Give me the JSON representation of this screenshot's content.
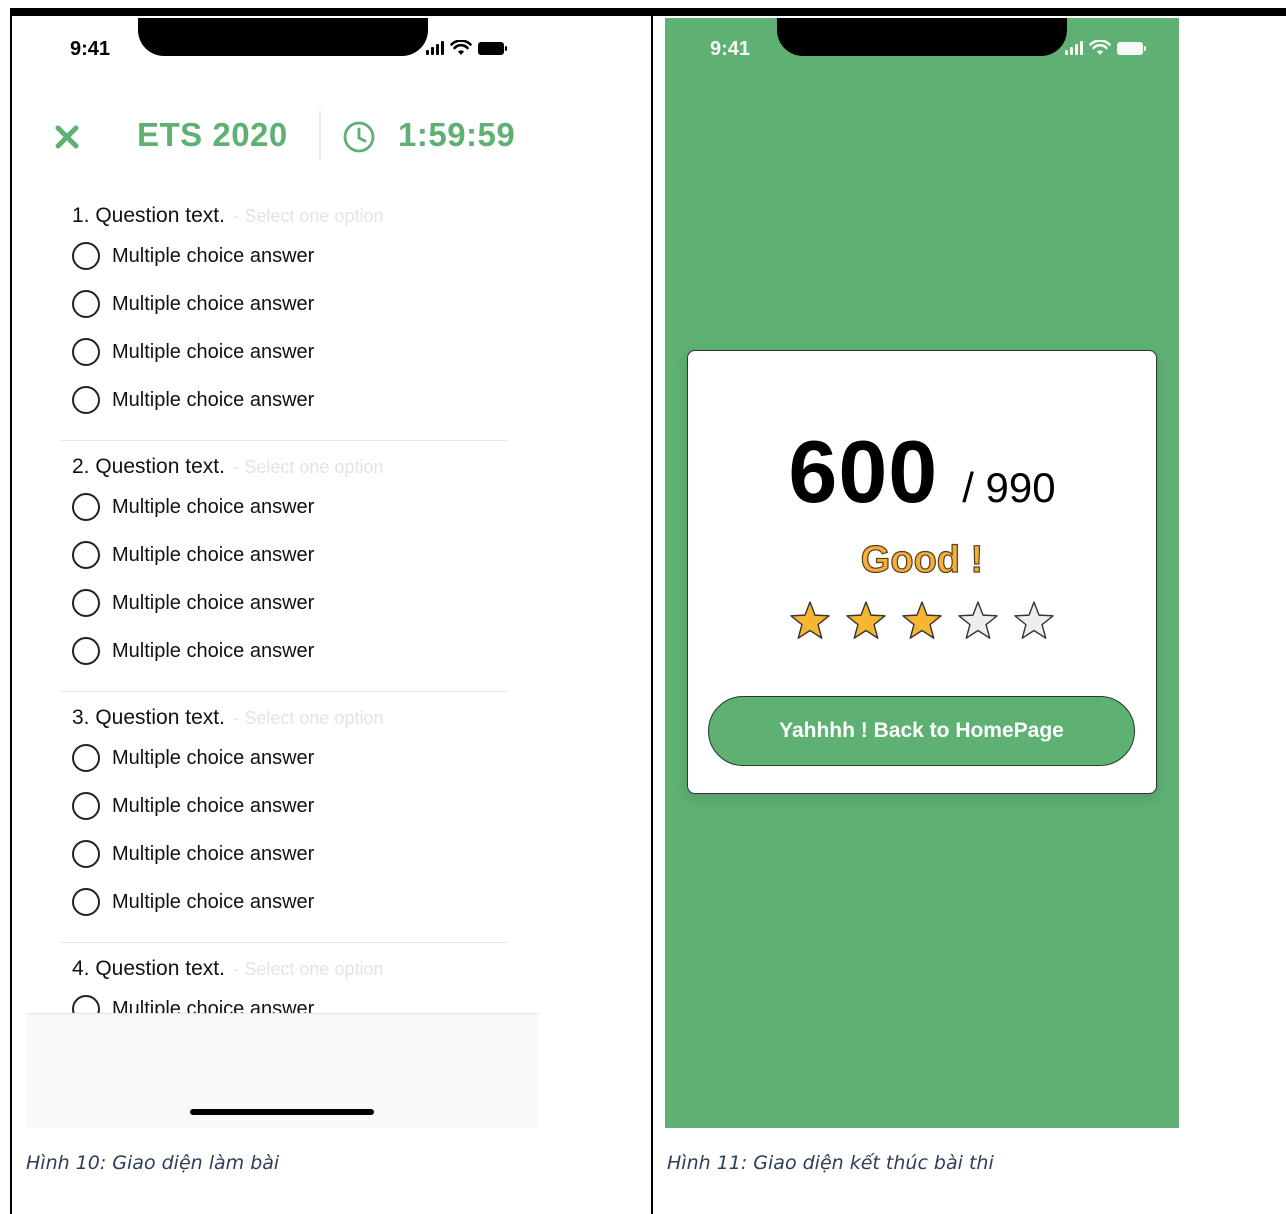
{
  "status_bar": {
    "time": "9:41"
  },
  "exam": {
    "title": "ETS 2020",
    "timer": "1:59:59",
    "close_icon": "close-icon",
    "clock_icon": "clock-icon",
    "accent_color": "#5eb073",
    "questions": [
      {
        "text": "1. Question text.",
        "hint": "- Select one option",
        "answers": [
          "Multiple choice answer",
          "Multiple choice answer",
          "Multiple choice answer",
          "Multiple choice answer"
        ]
      },
      {
        "text": "2. Question text.",
        "hint": "- Select one option",
        "answers": [
          "Multiple choice answer",
          "Multiple choice answer",
          "Multiple choice answer",
          "Multiple choice answer"
        ]
      },
      {
        "text": "3. Question text.",
        "hint": "- Select one option",
        "answers": [
          "Multiple choice answer",
          "Multiple choice answer",
          "Multiple choice answer",
          "Multiple choice answer"
        ]
      },
      {
        "text": "4. Question text.",
        "hint": "- Select one option",
        "answers": [
          "Multiple choice answer"
        ]
      }
    ]
  },
  "result": {
    "score": "600",
    "total": "/ 990",
    "rating_label": "Good !",
    "stars": {
      "filled": 3,
      "total": 5
    },
    "star_color": "#f7b632",
    "background_color": "#5eb073",
    "button_label": "Yahhhh ! Back to HomePage"
  },
  "captions": {
    "left": "Hình 10: Giao diện làm bài",
    "right": "Hình 11: Giao diện kết thúc bài thi"
  }
}
